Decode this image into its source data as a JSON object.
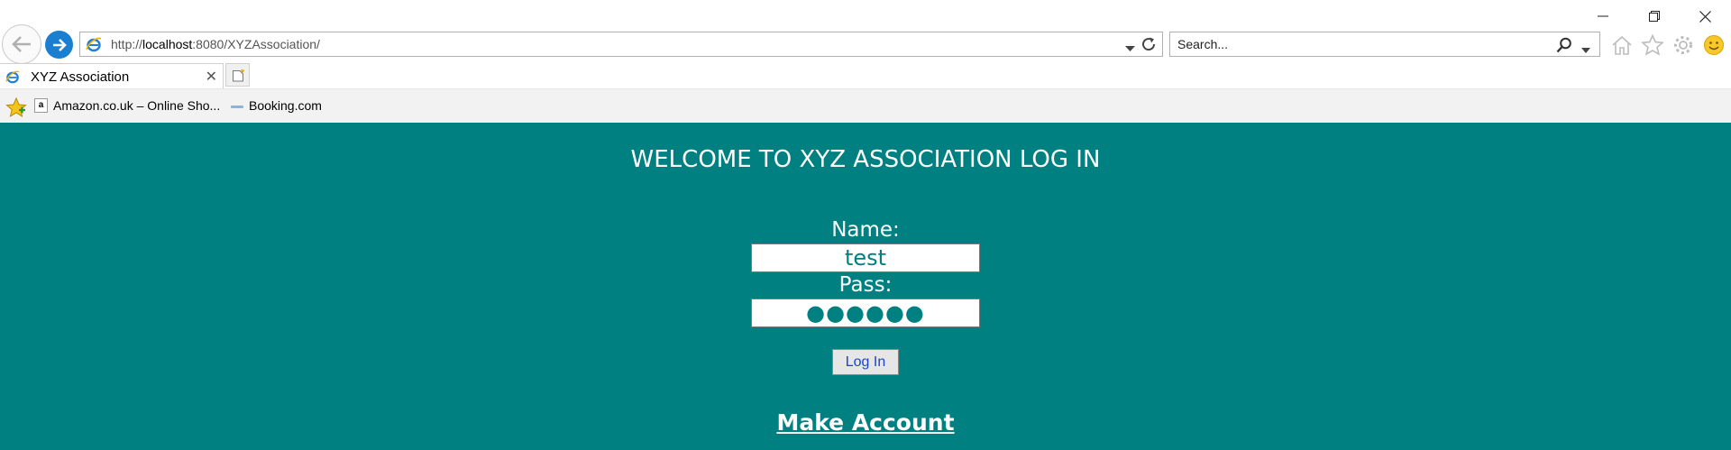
{
  "browser": {
    "url_prefix": "http://",
    "url_host": "localhost",
    "url_rest": ":8080/XYZAssociation/",
    "search_placeholder": "Search...",
    "tab_title": "XYZ Association",
    "favorites": [
      {
        "label": "Amazon.co.uk – Online Sho...",
        "icon": "amazon-a-icon"
      },
      {
        "label": "Booking.com",
        "icon": "booking-icon"
      }
    ],
    "accent_color": "#1a7fd0"
  },
  "page": {
    "background_color": "#008080",
    "heading": "WELCOME TO XYZ ASSOCIATION LOG IN",
    "name_label": "Name:",
    "name_value": "test",
    "pass_label": "Pass:",
    "pass_value": "●●●●●●",
    "login_button": "Log In",
    "make_account_link": "Make Account"
  }
}
